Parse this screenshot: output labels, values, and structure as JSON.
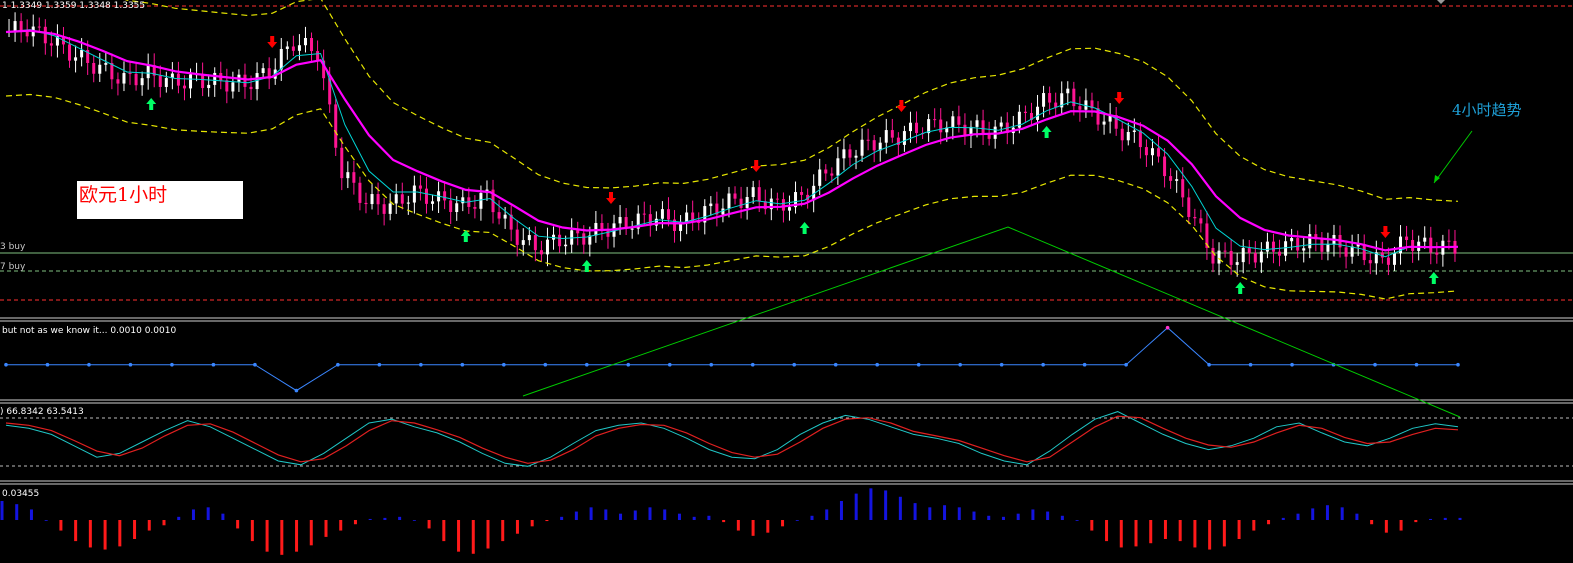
{
  "chart_data": [
    {
      "type": "candlestick",
      "panel": "price",
      "header_text": "1  1.3349 1.3359 1.3348 1.3355",
      "price_label_1": "3 buy",
      "price_label_2": "7 buy",
      "annotation_main": "欧元1小时",
      "annotation_trend": "4小时趋势",
      "colors": {
        "bull_candle": "#ffffff",
        "bear_candle": "#ff1493",
        "fast_ma": "#00d5d5",
        "slow_ma": "#ff00ff",
        "band": "#e6e600",
        "up_arrow": "#00ff66",
        "down_arrow": "#ff0000",
        "trendline": "#00cc00",
        "level_green": "#7fbf7f",
        "level_red": "#ff3030"
      },
      "series": [
        {
          "name": "close",
          "values": [
            1.337,
            1.3372,
            1.3366,
            1.3358,
            1.3352,
            1.3346,
            1.3349,
            1.3345,
            1.3346,
            1.3345,
            1.3344,
            1.335,
            1.3365,
            1.336,
            1.33,
            1.3285,
            1.3283,
            1.329,
            1.3286,
            1.3283,
            1.3288,
            1.327,
            1.3262,
            1.3266,
            1.3268,
            1.3272,
            1.3275,
            1.3278,
            1.3274,
            1.328,
            1.3285,
            1.3288,
            1.3283,
            1.3287,
            1.33,
            1.331,
            1.3315,
            1.3318,
            1.3323,
            1.3324,
            1.3322,
            1.332,
            1.3326,
            1.3335,
            1.3338,
            1.333,
            1.3322,
            1.3315,
            1.3302,
            1.3282,
            1.3258,
            1.3257,
            1.326,
            1.3263,
            1.3265,
            1.3264,
            1.326,
            1.3255,
            1.3266,
            1.3262,
            1.3263
          ]
        }
      ],
      "arrows_up": [
        6,
        19,
        24,
        33,
        43,
        51,
        59
      ],
      "arrows_down": [
        11,
        25,
        31,
        37,
        46,
        57
      ]
    },
    {
      "type": "line",
      "panel": "step_indicator",
      "header_text": " but not as we know it... 0.0010 0.0010",
      "series": [
        {
          "values": [
            0.45,
            0.45,
            0.45,
            0.45,
            0.45,
            0.45,
            0.45,
            0.1,
            0.45,
            0.45,
            0.45,
            0.45,
            0.45,
            0.45,
            0.45,
            0.45,
            0.45,
            0.45,
            0.45,
            0.45,
            0.45,
            0.45,
            0.45,
            0.45,
            0.45,
            0.45,
            0.45,
            0.45,
            0.95,
            0.45,
            0.45,
            0.45,
            0.45,
            0.45,
            0.45,
            0.45
          ]
        }
      ],
      "ylim": [
        0,
        1
      ]
    },
    {
      "type": "line",
      "panel": "stochastic",
      "header_text": ") 66.8342 63.5413",
      "series": [
        {
          "values": [
            72,
            68,
            60,
            45,
            30,
            35,
            50,
            65,
            78,
            70,
            55,
            40,
            25,
            20,
            35,
            55,
            75,
            80,
            70,
            62,
            50,
            35,
            22,
            18,
            30,
            48,
            65,
            72,
            75,
            68,
            55,
            40,
            30,
            28,
            40,
            60,
            75,
            85,
            80,
            70,
            60,
            55,
            48,
            35,
            25,
            20,
            38,
            60,
            80,
            90,
            75,
            60,
            48,
            40,
            45,
            55,
            70,
            75,
            62,
            50,
            45,
            55,
            68,
            74,
            70
          ]
        },
        {
          "values": [
            75,
            72,
            65,
            52,
            38,
            32,
            42,
            58,
            72,
            74,
            63,
            48,
            33,
            24,
            28,
            45,
            65,
            78,
            75,
            66,
            56,
            42,
            30,
            22,
            26,
            40,
            58,
            68,
            73,
            72,
            62,
            48,
            36,
            30,
            34,
            50,
            68,
            80,
            82,
            75,
            64,
            58,
            52,
            42,
            32,
            24,
            30,
            50,
            70,
            84,
            82,
            68,
            55,
            46,
            43,
            50,
            62,
            72,
            68,
            56,
            48,
            50,
            60,
            68,
            66
          ]
        }
      ],
      "ylim": [
        0,
        100
      ]
    },
    {
      "type": "bar",
      "panel": "histogram",
      "header_text": "0.03455",
      "series": [
        {
          "values": [
            0.018,
            0.015,
            0.01,
            0.0,
            -0.01,
            -0.02,
            -0.026,
            -0.028,
            -0.025,
            -0.018,
            -0.01,
            -0.005,
            0.003,
            0.01,
            0.012,
            0.006,
            -0.008,
            -0.02,
            -0.03,
            -0.033,
            -0.03,
            -0.024,
            -0.016,
            -0.01,
            -0.004,
            0.001,
            0.002,
            0.003,
            0.0,
            -0.008,
            -0.02,
            -0.03,
            -0.032,
            -0.027,
            -0.02,
            -0.013,
            -0.006,
            -0.001,
            0.003,
            0.008,
            0.012,
            0.01,
            0.006,
            0.009,
            0.012,
            0.01,
            0.006,
            0.003,
            0.004,
            -0.002,
            -0.01,
            -0.015,
            -0.012,
            -0.006,
            0.0,
            0.004,
            0.01,
            0.018,
            0.025,
            0.03,
            0.028,
            0.022,
            0.016,
            0.012,
            0.014,
            0.012,
            0.008,
            0.004,
            0.003,
            0.006,
            0.01,
            0.008,
            0.004,
            0.0,
            -0.01,
            -0.02,
            -0.026,
            -0.025,
            -0.022,
            -0.018,
            -0.02,
            -0.026,
            -0.028,
            -0.025,
            -0.018,
            -0.01,
            -0.004,
            0.002,
            0.006,
            0.011,
            0.014,
            0.012,
            0.006,
            -0.004,
            -0.012,
            -0.01,
            -0.002,
            0.001,
            0.002,
            0.002
          ]
        }
      ],
      "ylim": [
        -0.036,
        0.036
      ]
    }
  ]
}
